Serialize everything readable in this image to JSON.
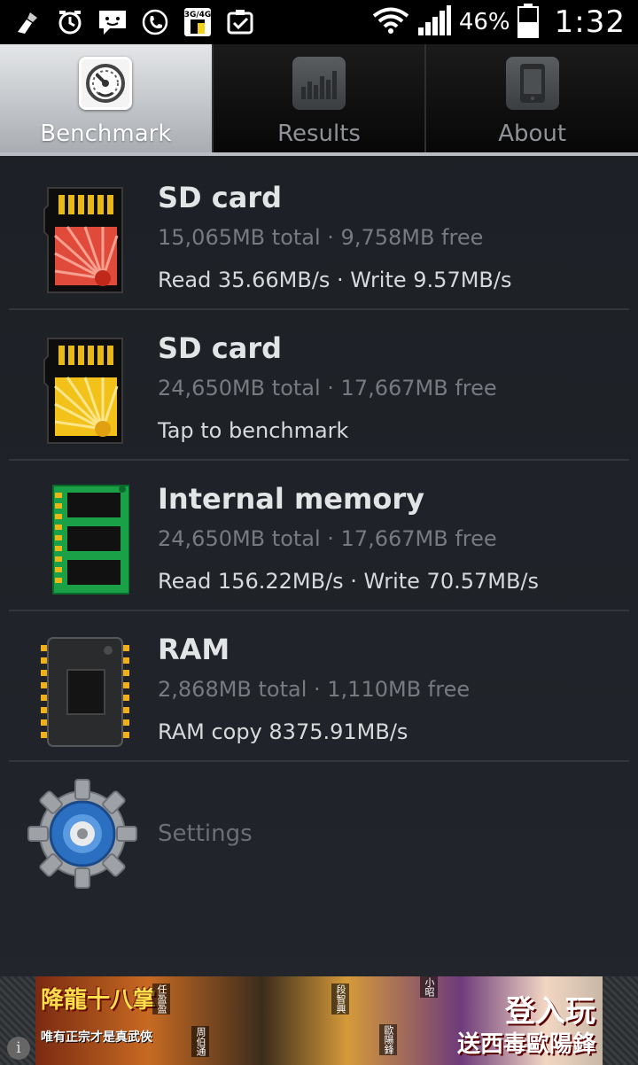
{
  "status_bar": {
    "icons": [
      "cleaner-icon",
      "alarm-icon",
      "message-icon",
      "call-icon",
      "sim-3g4g-icon",
      "clipboard-check-icon"
    ],
    "sim_label": "3G/4G",
    "battery_percent": "46%",
    "time": "1:32",
    "wifi_icon": "wifi-icon",
    "signal_icon": "signal-icon",
    "battery_icon": "battery-icon"
  },
  "tabs": [
    {
      "label": "Benchmark",
      "icon": "speedometer-icon",
      "active": true
    },
    {
      "label": "Results",
      "icon": "bar-chart-icon",
      "active": false
    },
    {
      "label": "About",
      "icon": "phone-icon",
      "active": false
    }
  ],
  "items": [
    {
      "title": "SD card",
      "sub": "15,065MB total · 9,758MB free",
      "stat": "Read 35.66MB/s · Write 9.57MB/s",
      "icon": "sd-card-red-icon"
    },
    {
      "title": "SD card",
      "sub": "24,650MB total · 17,667MB free",
      "stat": "Tap to benchmark",
      "icon": "sd-card-yellow-icon"
    },
    {
      "title": "Internal memory",
      "sub": "24,650MB total · 17,667MB free",
      "stat": "Read 156.22MB/s · Write 70.57MB/s",
      "icon": "memory-module-icon"
    },
    {
      "title": "RAM",
      "sub": "2,868MB total · 1,110MB free",
      "stat": "RAM copy 8375.91MB/s",
      "icon": "chip-icon"
    }
  ],
  "settings": {
    "label": "Settings",
    "icon": "settings-gear-icon"
  },
  "ad": {
    "left_title": "降龍十八掌",
    "left_sub": "唯有正宗才是真武俠",
    "names": [
      "任盈盈",
      "周伯通",
      "段智興",
      "小昭",
      "歐陽鋒"
    ],
    "cta_line1": "登入玩",
    "cta_line2": "送西毒歐陽鋒",
    "info_glyph": "i"
  }
}
